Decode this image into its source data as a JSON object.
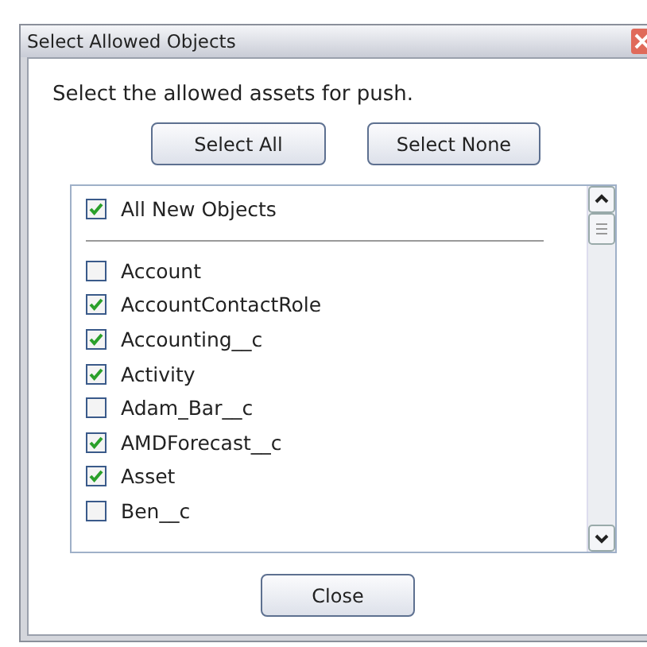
{
  "window": {
    "title": "Select Allowed Objects"
  },
  "instruction": "Select the allowed assets for push.",
  "top_buttons": [
    "Select All",
    "Select None"
  ],
  "all_new": {
    "label": "All New Objects",
    "checked": true
  },
  "objects": [
    {
      "label": "Account",
      "checked": false
    },
    {
      "label": "AccountContactRole",
      "checked": true
    },
    {
      "label": "Accounting__c",
      "checked": true
    },
    {
      "label": "Activity",
      "checked": true
    },
    {
      "label": "Adam_Bar__c",
      "checked": false
    },
    {
      "label": "AMDForecast__c",
      "checked": true
    },
    {
      "label": "Asset",
      "checked": true
    },
    {
      "label": "Ben__c",
      "checked": false
    }
  ],
  "close_button": "Close"
}
